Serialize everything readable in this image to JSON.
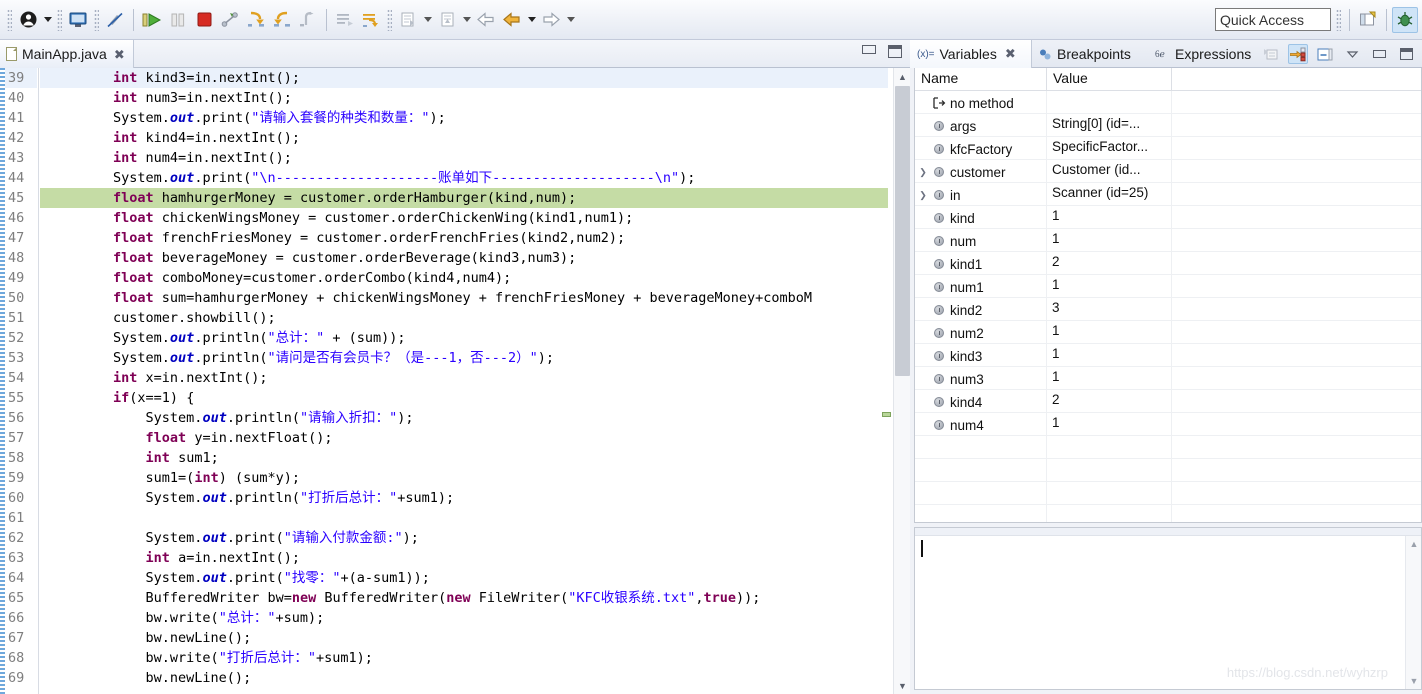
{
  "toolbar": {
    "icons": [
      {
        "name": "user-profile-icon",
        "glyph": "●"
      },
      {
        "name": "console-icon",
        "glyph": "▣"
      },
      {
        "name": "skip-breakpoints-icon",
        "glyph": "⊘"
      },
      {
        "name": "resume-icon",
        "glyph": "▶"
      },
      {
        "name": "suspend-icon",
        "glyph": "‖"
      },
      {
        "name": "terminate-icon",
        "glyph": "■"
      },
      {
        "name": "disconnect-icon",
        "glyph": "⎇"
      },
      {
        "name": "step-into-icon",
        "glyph": "⤵"
      },
      {
        "name": "step-over-icon",
        "glyph": "⤴"
      },
      {
        "name": "step-return-icon",
        "glyph": "⤴"
      },
      {
        "name": "drop-to-frame-icon",
        "glyph": "↰"
      },
      {
        "name": "use-step-filters-icon",
        "glyph": "↴"
      },
      {
        "name": "new-java-class-icon",
        "glyph": "▤"
      },
      {
        "name": "new-wizard-icon",
        "glyph": "▥"
      },
      {
        "name": "back-icon",
        "glyph": "⇦"
      },
      {
        "name": "previous-edit-icon",
        "glyph": "⇦"
      },
      {
        "name": "forward-icon",
        "glyph": "⇨"
      }
    ],
    "quick_access_placeholder": "Quick Access",
    "perspective_new_label": "open-perspective",
    "perspective_debug_label": "debug-perspective"
  },
  "editor": {
    "tab": {
      "title": "MainApp.java",
      "close_glyph": "✖"
    },
    "minimize_label": "Minimize",
    "maximize_label": "Maximize",
    "first_line_number": 39,
    "current_line_number": 39,
    "executing_line_number": 45,
    "lines": [
      {
        "n": 39,
        "tokens": [
          {
            "t": "        ",
            "c": "pln"
          },
          {
            "t": "int",
            "c": "kw"
          },
          {
            "t": " kind3=in.nextInt();",
            "c": "pln"
          }
        ]
      },
      {
        "n": 40,
        "tokens": [
          {
            "t": "        ",
            "c": "pln"
          },
          {
            "t": "int",
            "c": "kw"
          },
          {
            "t": " num3=in.nextInt();",
            "c": "pln"
          }
        ]
      },
      {
        "n": 41,
        "tokens": [
          {
            "t": "        System.",
            "c": "pln"
          },
          {
            "t": "out",
            "c": "fld"
          },
          {
            "t": ".print(",
            "c": "pln"
          },
          {
            "t": "\"请输入套餐的种类和数量：\"",
            "c": "str"
          },
          {
            "t": ");",
            "c": "pln"
          }
        ]
      },
      {
        "n": 42,
        "tokens": [
          {
            "t": "        ",
            "c": "pln"
          },
          {
            "t": "int",
            "c": "kw"
          },
          {
            "t": " kind4=in.nextInt();",
            "c": "pln"
          }
        ]
      },
      {
        "n": 43,
        "tokens": [
          {
            "t": "        ",
            "c": "pln"
          },
          {
            "t": "int",
            "c": "kw"
          },
          {
            "t": " num4=in.nextInt();",
            "c": "pln"
          }
        ]
      },
      {
        "n": 44,
        "tokens": [
          {
            "t": "        System.",
            "c": "pln"
          },
          {
            "t": "out",
            "c": "fld"
          },
          {
            "t": ".print(",
            "c": "pln"
          },
          {
            "t": "\"\\n--------------------账单如下--------------------\\n\"",
            "c": "str"
          },
          {
            "t": ");",
            "c": "pln"
          }
        ]
      },
      {
        "n": 45,
        "tokens": [
          {
            "t": "        ",
            "c": "pln"
          },
          {
            "t": "float",
            "c": "kw"
          },
          {
            "t": " hamhurgerMoney = customer.orderHamburger(kind,num);",
            "c": "pln"
          }
        ]
      },
      {
        "n": 46,
        "tokens": [
          {
            "t": "        ",
            "c": "pln"
          },
          {
            "t": "float",
            "c": "kw"
          },
          {
            "t": " chickenWingsMoney = customer.orderChickenWing(kind1,num1);",
            "c": "pln"
          }
        ]
      },
      {
        "n": 47,
        "tokens": [
          {
            "t": "        ",
            "c": "pln"
          },
          {
            "t": "float",
            "c": "kw"
          },
          {
            "t": " frenchFriesMoney = customer.orderFrenchFries(kind2,num2);",
            "c": "pln"
          }
        ]
      },
      {
        "n": 48,
        "tokens": [
          {
            "t": "        ",
            "c": "pln"
          },
          {
            "t": "float",
            "c": "kw"
          },
          {
            "t": " beverageMoney = customer.orderBeverage(kind3,num3);",
            "c": "pln"
          }
        ]
      },
      {
        "n": 49,
        "tokens": [
          {
            "t": "        ",
            "c": "pln"
          },
          {
            "t": "float",
            "c": "kw"
          },
          {
            "t": " comboMoney=customer.orderCombo(kind4,num4);",
            "c": "pln"
          }
        ]
      },
      {
        "n": 50,
        "tokens": [
          {
            "t": "        ",
            "c": "pln"
          },
          {
            "t": "float",
            "c": "kw"
          },
          {
            "t": " sum=hamhurgerMoney + chickenWingsMoney + frenchFriesMoney + beverageMoney+comboM",
            "c": "pln"
          }
        ]
      },
      {
        "n": 51,
        "tokens": [
          {
            "t": "        customer.showbill();",
            "c": "pln"
          }
        ]
      },
      {
        "n": 52,
        "tokens": [
          {
            "t": "        System.",
            "c": "pln"
          },
          {
            "t": "out",
            "c": "fld"
          },
          {
            "t": ".println(",
            "c": "pln"
          },
          {
            "t": "\"总计：\"",
            "c": "str"
          },
          {
            "t": " + (sum));",
            "c": "pln"
          }
        ]
      },
      {
        "n": 53,
        "tokens": [
          {
            "t": "        System.",
            "c": "pln"
          },
          {
            "t": "out",
            "c": "fld"
          },
          {
            "t": ".println(",
            "c": "pln"
          },
          {
            "t": "\"请问是否有会员卡？（是---1，否---2）\"",
            "c": "str"
          },
          {
            "t": ");",
            "c": "pln"
          }
        ]
      },
      {
        "n": 54,
        "tokens": [
          {
            "t": "        ",
            "c": "pln"
          },
          {
            "t": "int",
            "c": "kw"
          },
          {
            "t": " x=in.nextInt();",
            "c": "pln"
          }
        ]
      },
      {
        "n": 55,
        "tokens": [
          {
            "t": "        ",
            "c": "pln"
          },
          {
            "t": "if",
            "c": "kw"
          },
          {
            "t": "(x==1) {",
            "c": "pln"
          }
        ]
      },
      {
        "n": 56,
        "tokens": [
          {
            "t": "            System.",
            "c": "pln"
          },
          {
            "t": "out",
            "c": "fld"
          },
          {
            "t": ".println(",
            "c": "pln"
          },
          {
            "t": "\"请输入折扣：\"",
            "c": "str"
          },
          {
            "t": ");",
            "c": "pln"
          }
        ]
      },
      {
        "n": 57,
        "tokens": [
          {
            "t": "            ",
            "c": "pln"
          },
          {
            "t": "float",
            "c": "kw"
          },
          {
            "t": " y=in.nextFloat();",
            "c": "pln"
          }
        ]
      },
      {
        "n": 58,
        "tokens": [
          {
            "t": "            ",
            "c": "pln"
          },
          {
            "t": "int",
            "c": "kw"
          },
          {
            "t": " sum1;",
            "c": "pln"
          }
        ]
      },
      {
        "n": 59,
        "tokens": [
          {
            "t": "            sum1=(",
            "c": "pln"
          },
          {
            "t": "int",
            "c": "kw"
          },
          {
            "t": ") (sum*y);",
            "c": "pln"
          }
        ]
      },
      {
        "n": 60,
        "tokens": [
          {
            "t": "            System.",
            "c": "pln"
          },
          {
            "t": "out",
            "c": "fld"
          },
          {
            "t": ".println(",
            "c": "pln"
          },
          {
            "t": "\"打折后总计：\"",
            "c": "str"
          },
          {
            "t": "+sum1);",
            "c": "pln"
          }
        ]
      },
      {
        "n": 61,
        "tokens": [
          {
            "t": "",
            "c": "pln"
          }
        ]
      },
      {
        "n": 62,
        "tokens": [
          {
            "t": "            System.",
            "c": "pln"
          },
          {
            "t": "out",
            "c": "fld"
          },
          {
            "t": ".print(",
            "c": "pln"
          },
          {
            "t": "\"请输入付款金额:\"",
            "c": "str"
          },
          {
            "t": ");",
            "c": "pln"
          }
        ]
      },
      {
        "n": 63,
        "tokens": [
          {
            "t": "            ",
            "c": "pln"
          },
          {
            "t": "int",
            "c": "kw"
          },
          {
            "t": " a=in.nextInt();",
            "c": "pln"
          }
        ]
      },
      {
        "n": 64,
        "tokens": [
          {
            "t": "            System.",
            "c": "pln"
          },
          {
            "t": "out",
            "c": "fld"
          },
          {
            "t": ".print(",
            "c": "pln"
          },
          {
            "t": "\"找零：\"",
            "c": "str"
          },
          {
            "t": "+(a-sum1));",
            "c": "pln"
          }
        ]
      },
      {
        "n": 65,
        "tokens": [
          {
            "t": "            BufferedWriter bw=",
            "c": "pln"
          },
          {
            "t": "new",
            "c": "kw"
          },
          {
            "t": " BufferedWriter(",
            "c": "pln"
          },
          {
            "t": "new",
            "c": "kw"
          },
          {
            "t": " FileWriter(",
            "c": "pln"
          },
          {
            "t": "\"KFC收银系统.txt\"",
            "c": "str"
          },
          {
            "t": ",",
            "c": "pln"
          },
          {
            "t": "true",
            "c": "kw"
          },
          {
            "t": "));",
            "c": "pln"
          }
        ]
      },
      {
        "n": 66,
        "tokens": [
          {
            "t": "            bw.write(",
            "c": "pln"
          },
          {
            "t": "\"总计：\"",
            "c": "str"
          },
          {
            "t": "+sum);",
            "c": "pln"
          }
        ]
      },
      {
        "n": 67,
        "tokens": [
          {
            "t": "            bw.newLine();",
            "c": "pln"
          }
        ]
      },
      {
        "n": 68,
        "tokens": [
          {
            "t": "            bw.write(",
            "c": "pln"
          },
          {
            "t": "\"打折后总计：\"",
            "c": "str"
          },
          {
            "t": "+sum1);",
            "c": "pln"
          }
        ]
      },
      {
        "n": 69,
        "tokens": [
          {
            "t": "            bw.newLine();",
            "c": "pln"
          }
        ]
      }
    ]
  },
  "views": {
    "tabs": [
      {
        "label": "Variables",
        "icon": "(x)=",
        "selected": true,
        "closable": true
      },
      {
        "label": "Breakpoints",
        "icon": "●○",
        "selected": false,
        "closable": false
      },
      {
        "label": "Expressions",
        "icon": "6ⅇ",
        "selected": false,
        "closable": false
      }
    ],
    "tools": [
      {
        "name": "collapse-all-icon",
        "glyph": "⬌",
        "active": false
      },
      {
        "name": "show-logical-structure-icon",
        "glyph": "⇨",
        "active": true
      },
      {
        "name": "toggle-detail-pane-icon",
        "glyph": "⊟",
        "active": false
      },
      {
        "name": "view-menu-icon",
        "glyph": "▽",
        "active": false
      },
      {
        "name": "minimize-icon",
        "glyph": "−",
        "active": false
      },
      {
        "name": "maximize-icon",
        "glyph": "❐",
        "active": false
      }
    ],
    "variables": {
      "columns": [
        "Name",
        "Value"
      ],
      "rows": [
        {
          "name": "no method",
          "value": "",
          "icon": "method-exit-icon",
          "expandable": false,
          "indent": 1
        },
        {
          "name": "args",
          "value": "String[0]  (id=...",
          "icon": "local-variable-icon",
          "expandable": false,
          "indent": 1
        },
        {
          "name": "kfcFactory",
          "value": "SpecificFactor...",
          "icon": "local-variable-icon",
          "expandable": false,
          "indent": 1
        },
        {
          "name": "customer",
          "value": "Customer  (id...",
          "icon": "local-variable-icon",
          "expandable": true,
          "indent": 1
        },
        {
          "name": "in",
          "value": "Scanner  (id=25)",
          "icon": "local-variable-icon",
          "expandable": true,
          "indent": 1
        },
        {
          "name": "kind",
          "value": "1",
          "icon": "local-variable-icon",
          "expandable": false,
          "indent": 1
        },
        {
          "name": "num",
          "value": "1",
          "icon": "local-variable-icon",
          "expandable": false,
          "indent": 1
        },
        {
          "name": "kind1",
          "value": "2",
          "icon": "local-variable-icon",
          "expandable": false,
          "indent": 1
        },
        {
          "name": "num1",
          "value": "1",
          "icon": "local-variable-icon",
          "expandable": false,
          "indent": 1
        },
        {
          "name": "kind2",
          "value": "3",
          "icon": "local-variable-icon",
          "expandable": false,
          "indent": 1
        },
        {
          "name": "num2",
          "value": "1",
          "icon": "local-variable-icon",
          "expandable": false,
          "indent": 1
        },
        {
          "name": "kind3",
          "value": "1",
          "icon": "local-variable-icon",
          "expandable": false,
          "indent": 1
        },
        {
          "name": "num3",
          "value": "1",
          "icon": "local-variable-icon",
          "expandable": false,
          "indent": 1
        },
        {
          "name": "kind4",
          "value": "2",
          "icon": "local-variable-icon",
          "expandable": false,
          "indent": 1
        },
        {
          "name": "num4",
          "value": "1",
          "icon": "local-variable-icon",
          "expandable": false,
          "indent": 1
        },
        {
          "name": "",
          "value": "",
          "icon": "",
          "expandable": false,
          "indent": 0
        },
        {
          "name": "",
          "value": "",
          "icon": "",
          "expandable": false,
          "indent": 0
        },
        {
          "name": "",
          "value": "",
          "icon": "",
          "expandable": false,
          "indent": 0
        },
        {
          "name": "",
          "value": "",
          "icon": "",
          "expandable": false,
          "indent": 0
        }
      ]
    },
    "detail_pane": {
      "text": ""
    }
  },
  "watermark": "https://blog.csdn.net/wyhzrp",
  "colors": {
    "executing_line": "#c5dca5",
    "current_line": "#eaf1fb",
    "keyword": "#7f0055",
    "string": "#2a00ff",
    "field": "#0000c0",
    "active_tool": "#cfe4f7"
  }
}
